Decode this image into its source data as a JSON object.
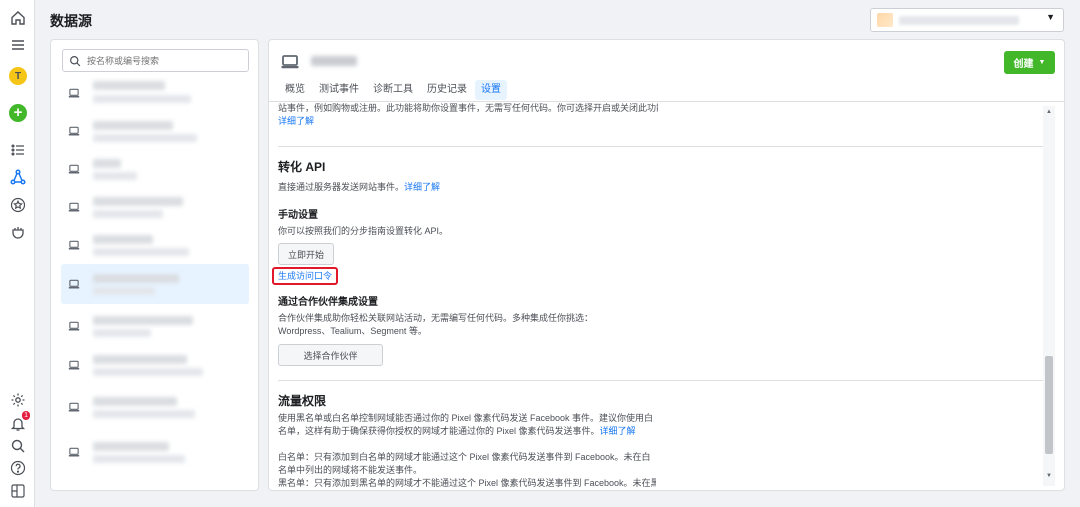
{
  "header": {
    "page_title": "数据源"
  },
  "rail": {
    "items": [
      "home-icon",
      "menu-icon",
      "avatar-icon",
      "add-icon",
      "list-icon",
      "data-sources-icon",
      "star-icon",
      "partner-icon",
      "settings-icon",
      "notifications-icon",
      "search-icon",
      "help-icon",
      "panel-icon"
    ],
    "avatar_letter": "T",
    "add_symbol": "+",
    "notification_count": "1"
  },
  "source_list": {
    "search_placeholder": "按名称或编号搜索"
  },
  "main": {
    "create_button": "创建",
    "tabs": [
      {
        "label": "概览",
        "active": false
      },
      {
        "label": "测试事件",
        "active": false
      },
      {
        "label": "诊断工具",
        "active": false
      },
      {
        "label": "历史记录",
        "active": false
      },
      {
        "label": "设置",
        "active": true
      }
    ],
    "top_text": "站事件，例如购物或注册。此功能将助你设置事件，无需写任何代码。你可选择开启或关闭此功能。",
    "top_link": "详细了解",
    "conversions_api": {
      "title": "转化 API",
      "description": "直接通过服务器发送网站事件。",
      "link": "详细了解",
      "manual_title": "手动设置",
      "manual_description": "你可以按照我们的分步指南设置转化 API。",
      "start_button": "立即开始",
      "token_link": "生成访问口令",
      "partner_title": "通过合作伙伴集成设置",
      "partner_description": "合作伙伴集成助你轻松关联网站活动，无需编写任何代码。多种集成任你挑选：Wordpress、Tealium、Segment 等。",
      "partner_button": "选择合作伙伴"
    },
    "traffic_permissions": {
      "title": "流量权限",
      "description": "使用黑名单或白名单控制网域能否通过你的 Pixel 像素代码发送 Facebook 事件。建议你使用白名单，这样有助于确保获得你授权的网域才能通过你的 Pixel 像素代码发送事件。",
      "link": "详细了解",
      "whitelist": "白名单：只有添加到白名单的网域才能通过这个 Pixel 像素代码发送事件到 Facebook。未在白名单中列出的网域将不能发送事件。",
      "blacklist": "黑名单：只有添加到黑名单的网域才不能通过这个 Pixel 像素代码发送事件到 Facebook。未在黑"
    }
  }
}
